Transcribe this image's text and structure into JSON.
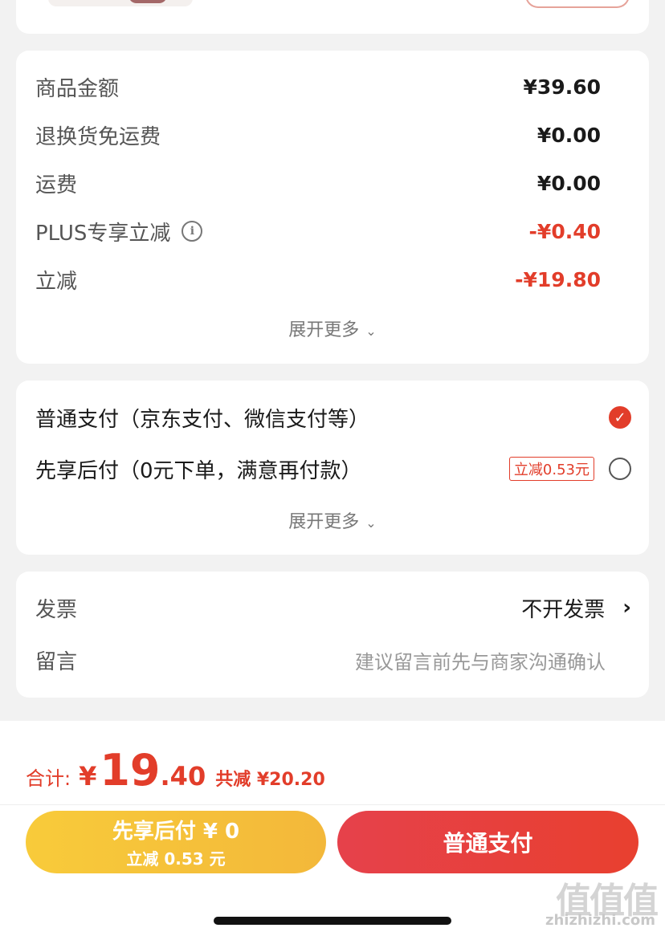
{
  "summary": {
    "rows": [
      {
        "label": "商品金额",
        "value": "¥39.60"
      },
      {
        "label": "退换货免运费",
        "value": "¥0.00"
      },
      {
        "label": "运费",
        "value": "¥0.00"
      },
      {
        "label": "PLUS专享立减",
        "value": "-¥0.40",
        "info_icon": "info-icon"
      },
      {
        "label": "立减",
        "value": "-¥19.80"
      }
    ],
    "more": "展开更多"
  },
  "payment": {
    "options": [
      {
        "label": "普通支付（京东支付、微信支付等）",
        "checked": true
      },
      {
        "label": "先享后付（0元下单，满意再付款）",
        "tag": "立减0.53元",
        "checked": false
      }
    ],
    "more": "展开更多"
  },
  "extra": {
    "invoice_label": "发票",
    "invoice_value": "不开发票",
    "message_label": "留言",
    "message_placeholder": "建议留言前先与商家沟通确认"
  },
  "footer": {
    "total_label": "合计:",
    "currency": "¥",
    "total_int": "19",
    "total_dec": ".40",
    "saved": "共减 ¥20.20",
    "later_btn_line1": "先享后付 ¥ 0",
    "later_btn_line2": "立减 0.53 元",
    "pay_btn": "普通支付"
  },
  "watermark": {
    "logo": "值值值",
    "site": "zhizhizhi.com"
  },
  "colors": {
    "accent": "#e23d2a",
    "yellow_button": "#f5c23a",
    "red_button": "#e6414b"
  }
}
